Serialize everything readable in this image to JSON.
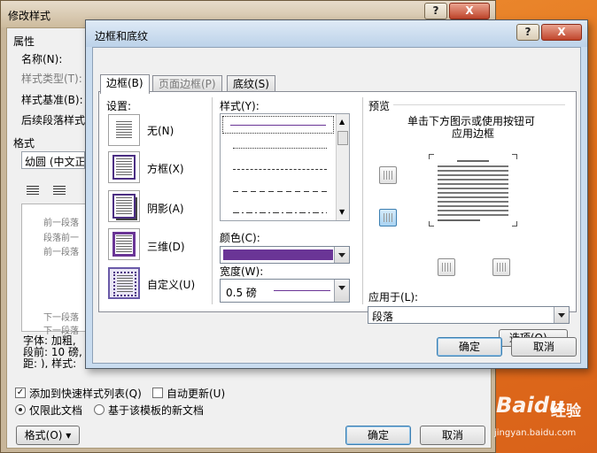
{
  "outer": {
    "title": "修改样式",
    "props_title": "属性",
    "name_label": "名称(N):",
    "style_type_label": "样式类型(T):",
    "based_on_label": "样式基准(B):",
    "next_para_label": "后续段落样式",
    "format_title": "格式",
    "font_value": "幼圆 (中文正",
    "preview_lines": [
      "前一段落",
      "段落前一",
      "前一段落",
      "下一段落",
      "下一段落"
    ],
    "desc_line1": "字体: 加粗,",
    "desc_line2": "段前: 10 磅,",
    "desc_line3": "距: ), 样式:",
    "add_to_quick_label": "添加到快速样式列表(Q)",
    "auto_update_label": "自动更新(U)",
    "only_doc_label": "仅限此文档",
    "new_docs_label": "基于该模板的新文档",
    "format_btn": "格式(O)",
    "ok_btn": "确定",
    "cancel_btn": "取消",
    "help_icon": "?",
    "close_icon": "X"
  },
  "inner": {
    "title": "边框和底纹",
    "help_icon": "?",
    "close_icon": "X",
    "tabs": [
      "边框(B)",
      "页面边框(P)",
      "底纹(S)"
    ],
    "settings_label": "设置:",
    "settings": [
      "无(N)",
      "方框(X)",
      "阴影(A)",
      "三维(D)",
      "自定义(U)"
    ],
    "style_label": "样式(Y):",
    "color_label": "颜色(C):",
    "color_value": "#6a3596",
    "width_label": "宽度(W):",
    "width_value": "0.5 磅",
    "preview_label": "预览",
    "preview_hint_1": "单击下方图示或使用按钮可",
    "preview_hint_2": "应用边框",
    "apply_to_label": "应用于(L):",
    "apply_to_value": "段落",
    "options_btn": "选项(O)...",
    "ok_btn": "确定",
    "cancel_btn": "取消"
  },
  "watermark": {
    "brand": "Baidu",
    "cn": "经验",
    "url": "jingyan.baidu.com"
  }
}
